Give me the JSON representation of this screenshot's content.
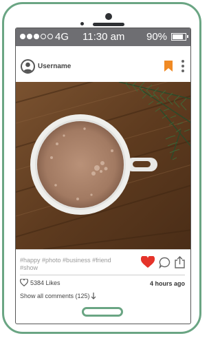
{
  "status_bar": {
    "signal_filled": 3,
    "signal_total": 5,
    "network": "4G",
    "time": "11:30 am",
    "battery": "90%",
    "battery_level": 0.9
  },
  "post": {
    "username": "Username",
    "hashtags_line1": "#happy #photo #business #friend",
    "hashtags_line2": "#show",
    "likes": "5384 Likes",
    "time_ago": "4 hours ago",
    "show_comments": "Show all comments (125)"
  },
  "colors": {
    "phone_frame": "#6aa583",
    "status_bar": "#6e6e72",
    "bookmark": "#f08a24",
    "heart": "#e5332a"
  },
  "icons": {
    "avatar": "user-avatar-icon",
    "bookmark": "bookmark-icon",
    "more": "more-vertical-icon",
    "like": "heart-icon",
    "comment": "comment-icon",
    "share": "share-icon",
    "likes_heart": "heart-outline-icon",
    "comments_arrow": "arrow-down-icon"
  }
}
